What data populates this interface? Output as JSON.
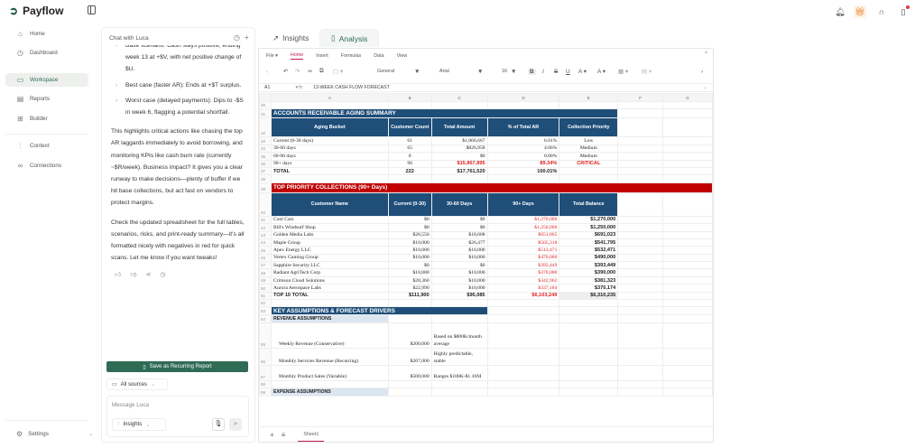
{
  "app": {
    "name": "Payflow"
  },
  "sidebar": {
    "items": [
      {
        "label": "Home",
        "icon": "⌂"
      },
      {
        "label": "Dashboard",
        "icon": "◷"
      },
      {
        "label": "Workspace",
        "icon": "▭",
        "selected": true
      },
      {
        "label": "Reports",
        "icon": "▤"
      },
      {
        "label": "Builder",
        "icon": "⊞"
      },
      {
        "label": "Context",
        "icon": "⫶"
      },
      {
        "label": "Connections",
        "icon": "∞"
      }
    ],
    "settings": "Settings"
  },
  "chat": {
    "title": "Chat with Luca",
    "bullets": [
      "Base scenario: Cash stays positive, ending week 13 at +$V, with net positive change of $U.",
      "Best case (faster AR): Ends at +$T surplus.",
      "Worst case (delayed payments): Dips to -$S in week 6, flagging a potential shortfall."
    ],
    "paragraphs": [
      "This highlights critical actions like chasing the top AR laggards immediately to avoid borrowing, and monitoring KPIs like cash burn rate (currently ~$R/week). Business impact? It gives you a clear runway to make decisions—plenty of buffer if we hit base collections, but act fast on vendors to protect margins.",
      "Check the updated spreadsheet for the full tables, scenarios, risks, and print-ready summary—it's all formatted nicely with negatives in red for quick scans. Let me know if you want tweaks!"
    ],
    "save_label": "Save as Recurring Report",
    "sources_label": "All sources",
    "message_placeholder": "Message Luca",
    "mode_label": "Insights"
  },
  "tabs": [
    {
      "label": "Insights"
    },
    {
      "label": "Analysis",
      "active": true
    }
  ],
  "sheet": {
    "menu": [
      "File",
      "Home",
      "Insert",
      "Formulas",
      "Data",
      "View"
    ],
    "format": "General",
    "font": "Arial",
    "font_size": "16",
    "cell_ref": "A1",
    "formula": "13-WEEK CASH FLOW FORECAST",
    "columns": [
      "A",
      "B",
      "C",
      "D",
      "E",
      "F",
      "G"
    ],
    "sheet_tab": "Sheet1",
    "rows": [
      {
        "n": "30",
        "kind": "blank",
        "cells": []
      },
      {
        "n": "31",
        "kind": "sec-blue",
        "cells": [
          "ACCOUNTS RECEIVABLE AGING SUMMARY"
        ]
      },
      {
        "n": "32",
        "kind": "hdr",
        "cells": [
          "Aging Bucket",
          "Customer Count",
          "Total Amount",
          "% of Total AR",
          "Collection Priority"
        ]
      },
      {
        "n": "33",
        "kind": "ar",
        "cells": [
          "Current (0-30 days)",
          "61",
          "$1,066,667",
          "6.01%",
          "Low"
        ]
      },
      {
        "n": "34",
        "kind": "ar",
        "cells": [
          "30-60 days",
          "65",
          "$826,958",
          "4.66%",
          "Medium"
        ]
      },
      {
        "n": "35",
        "kind": "ar",
        "cells": [
          "60-90 days",
          "0",
          "$0",
          "0.00%",
          "Medium"
        ]
      },
      {
        "n": "36",
        "kind": "ar-crit",
        "cells": [
          "90+ days",
          "96",
          "$15,867,895",
          "89.34%",
          "CRITICAL"
        ]
      },
      {
        "n": "37",
        "kind": "ar-total",
        "cells": [
          "TOTAL",
          "222",
          "$17,761,520",
          "100.01%",
          ""
        ]
      },
      {
        "n": "38",
        "kind": "blank",
        "cells": []
      },
      {
        "n": "39",
        "kind": "sec-red",
        "cells": [
          "TOP PRIORITY COLLECTIONS (90+ Days)"
        ]
      },
      {
        "n": "40",
        "kind": "hdr",
        "cells": [
          "Customer Name",
          "Current (0-30)",
          "30-60 Days",
          "90+ Days",
          "Total Balance"
        ]
      },
      {
        "n": "41",
        "kind": "cust",
        "cells": [
          "Cool Cars",
          "$0",
          "$0",
          "$1,270,000",
          "$1,270,000"
        ]
      },
      {
        "n": "42",
        "kind": "cust",
        "cells": [
          "Bill's Windsurf Shop",
          "$0",
          "$0",
          "$1,250,000",
          "$1,250,000"
        ]
      },
      {
        "n": "43",
        "kind": "cust",
        "cells": [
          "Golden Media Labs",
          "$20,550",
          "$18,608",
          "$651,865",
          "$691,023"
        ]
      },
      {
        "n": "44",
        "kind": "cust",
        "cells": [
          "Maple Group",
          "$10,000",
          "$26,477",
          "$505,318",
          "$541,795"
        ]
      },
      {
        "n": "45",
        "kind": "cust",
        "cells": [
          "Apex Energy LLC",
          "$10,000",
          "$10,000",
          "$512,471",
          "$532,471"
        ]
      },
      {
        "n": "46",
        "kind": "cust",
        "cells": [
          "Vertex Gaming Group",
          "$10,000",
          "$10,000",
          "$470,000",
          "$490,000"
        ]
      },
      {
        "n": "47",
        "kind": "cust",
        "cells": [
          "Sapphire Security LLC",
          "$0",
          "$0",
          "$393,449",
          "$393,449"
        ]
      },
      {
        "n": "48",
        "kind": "cust",
        "cells": [
          "Radiant AgriTech Corp",
          "$10,000",
          "$10,000",
          "$370,000",
          "$390,000"
        ]
      },
      {
        "n": "49",
        "kind": "cust",
        "cells": [
          "Crimson Cloud Solutions",
          "$28,360",
          "$10,000",
          "$342,962",
          "$381,323"
        ]
      },
      {
        "n": "50",
        "kind": "cust",
        "cells": [
          "Aurora Aerospace Labs",
          "$22,990",
          "$10,000",
          "$337,184",
          "$370,174"
        ]
      },
      {
        "n": "51",
        "kind": "cust-total",
        "cells": [
          "TOP 10 TOTAL",
          "$111,900",
          "$95,085",
          "$6,103,249",
          "$6,310,235"
        ]
      },
      {
        "n": "52",
        "kind": "blank",
        "cells": []
      },
      {
        "n": "53",
        "kind": "sec-blue-short",
        "cells": [
          "KEY ASSUMPTIONS & FORECAST DRIVERS"
        ]
      },
      {
        "n": "54",
        "kind": "sub",
        "cells": [
          "REVENUE ASSUMPTIONS"
        ]
      },
      {
        "n": "55",
        "kind": "assump",
        "cells": [
          "Weekly Revenue (Conservative)",
          "$200,000",
          "Based on $800K/month average"
        ]
      },
      {
        "n": "56",
        "kind": "assump",
        "cells": [
          "Monthly Services Revenue (Recurring)",
          "$267,000",
          "Highly predictable, stable"
        ]
      },
      {
        "n": "57",
        "kind": "assump",
        "cells": [
          "Monthly Product Sales (Variable)",
          "$500,000",
          "Ranges $100K-$1.16M"
        ]
      },
      {
        "n": "58",
        "kind": "blank",
        "cells": []
      },
      {
        "n": "59",
        "kind": "sub",
        "cells": [
          "EXPENSE ASSUMPTIONS"
        ]
      }
    ]
  },
  "colors": {
    "brand": "#2f6b55",
    "header_blue": "#1f4e79",
    "alert_red": "#c00000",
    "negative": "#e02020"
  }
}
